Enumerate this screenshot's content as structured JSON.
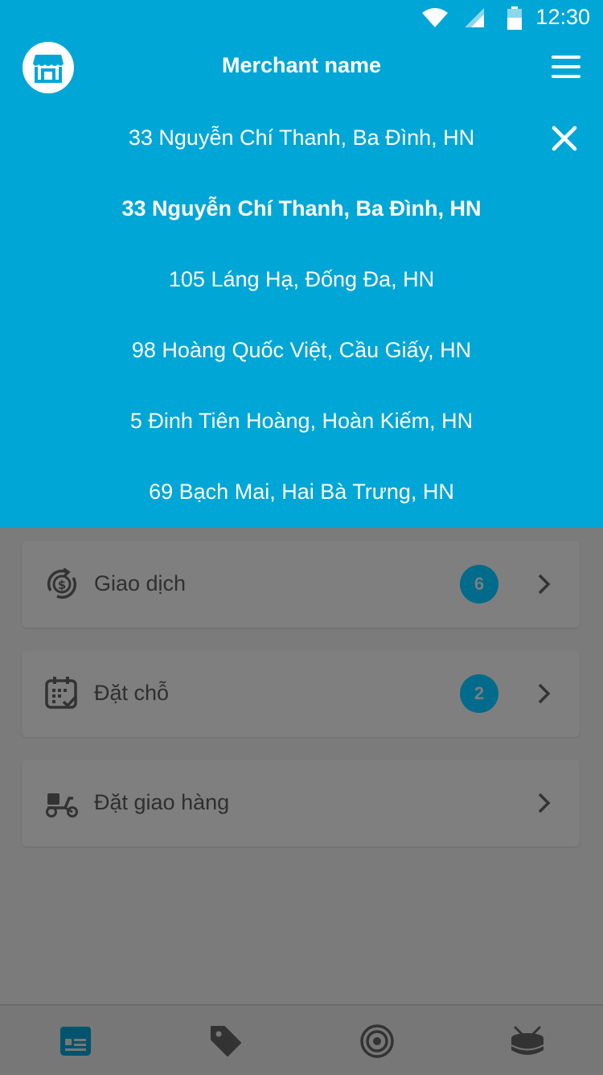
{
  "status_bar": {
    "time": "12:30"
  },
  "header": {
    "title": "Merchant name"
  },
  "addresses": [
    {
      "label": "33 Nguyễn Chí Thanh, Ba Đình, HN"
    },
    {
      "label": "33 Nguyễn Chí Thanh, Ba Đình, HN"
    },
    {
      "label": "105 Láng Hạ, Đống Đa, HN"
    },
    {
      "label": "98 Hoàng Quốc Việt, Cầu Giấy, HN"
    },
    {
      "label": "5 Đinh Tiên Hoàng, Hoàn Kiếm, HN"
    },
    {
      "label": "69 Bạch Mai, Hai Bà Trưng, HN"
    }
  ],
  "cards": [
    {
      "label": "Giao dịch",
      "badge": "6",
      "icon": "money-cycle-icon"
    },
    {
      "label": "Đặt chỗ",
      "badge": "2",
      "icon": "calendar-icon"
    },
    {
      "label": "Đặt giao hàng",
      "badge": "",
      "icon": "delivery-scooter-icon"
    }
  ],
  "bottom_nav": [
    {
      "icon": "dashboard-card-icon",
      "active": true
    },
    {
      "icon": "tag-icon",
      "active": false
    },
    {
      "icon": "target-icon",
      "active": false
    },
    {
      "icon": "drum-icon",
      "active": false
    }
  ],
  "colors": {
    "primary": "#00a6d6",
    "overlay": "#7b7b7b",
    "badge": "#006b8b"
  }
}
